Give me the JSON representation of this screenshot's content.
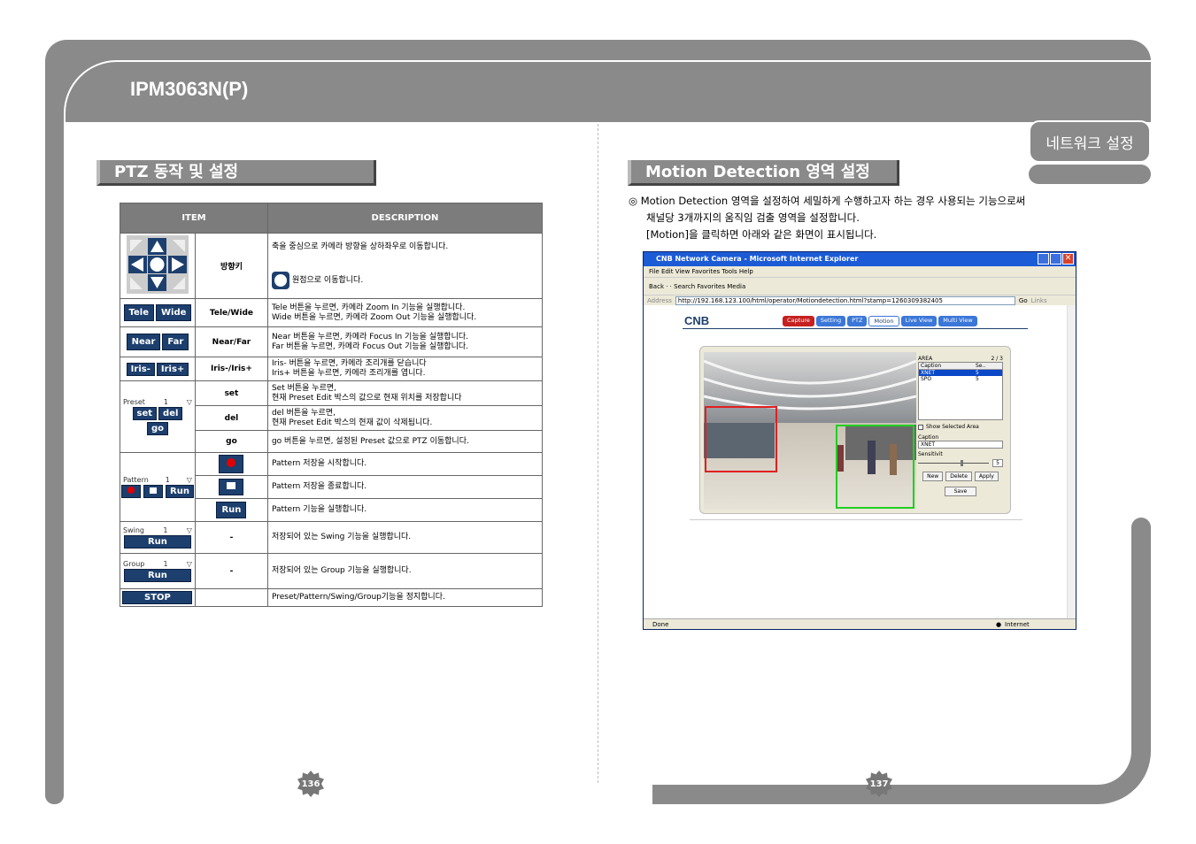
{
  "header": {
    "title": "IPM3063N(P)",
    "section_tab": "네트워크 설정"
  },
  "left": {
    "heading": "PTZ 동작 및 설정",
    "table": {
      "col_item": "ITEM",
      "col_desc": "DESCRIPTION",
      "rows": {
        "dir": {
          "name": "방향키",
          "desc1": "축을 중심으로 카메라 방향을 상하좌우로 이동합니다.",
          "desc2": "원점으로 이동합니다."
        },
        "tele": {
          "btn1": "Tele",
          "btn2": "Wide",
          "name": "Tele/Wide",
          "desc1": "Tele 버튼을 누르면, 카메라 Zoom In 기능을 실행합니다.",
          "desc2": "Wide 버튼을 누르면, 카메라 Zoom Out 기능을 실행합니다."
        },
        "near": {
          "btn1": "Near",
          "btn2": "Far",
          "name": "Near/Far",
          "desc1": "Near 버튼을 누르면, 카메라 Focus In 기능을 실행합니다.",
          "desc2": "Far 버튼을 누르면, 카메라 Focus Out 기능을 실행합니다."
        },
        "iris": {
          "btn1": "Iris-",
          "btn2": "Iris+",
          "name": "Iris-/Iris+",
          "desc1": "Iris- 버튼을 누르면, 카메라 조리개를 닫습니다",
          "desc2": "Iris+ 버튼을 누르면, 카메라 조리개를 엽니다."
        },
        "preset": {
          "label": "Preset",
          "value": "1",
          "btn_set": "set",
          "btn_del": "del",
          "btn_go": "go",
          "set_name": "set",
          "set_desc1": "Set 버튼을 누르면,",
          "set_desc2": "현재 Preset Edit 박스의 값으로 현재 위치를 저장합니다",
          "del_name": "del",
          "del_desc1": "del 버튼을 누르면,",
          "del_desc2": "현재 Preset Edit 박스의 현재 값이 삭제됩니다.",
          "go_name": "go",
          "go_desc": "go 버튼을 누르면, 설정된 Preset 값으로 PTZ 이동합니다."
        },
        "pattern": {
          "label": "Pattern",
          "value": "1",
          "run": "Run",
          "desc_rec": "Pattern 저장을 시작합니다.",
          "desc_stop": "Pattern 저장을 종료합니다.",
          "desc_run": "Pattern 기능을 실행합니다."
        },
        "swing": {
          "label": "Swing",
          "value": "1",
          "run": "Run",
          "name": "-",
          "desc": "저장되어 있는 Swing 기능을 실행합니다."
        },
        "group": {
          "label": "Group",
          "value": "1",
          "run": "Run",
          "name": "-",
          "desc": "저장되어 있는 Group 기능을 실행합니다."
        },
        "stop": {
          "btn": "STOP",
          "desc": "Preset/Pattern/Swing/Group기능을 정지합니다."
        }
      }
    },
    "page": "136"
  },
  "right": {
    "heading": "Motion Detection 영역 설정",
    "intro1": "◎ Motion Detection 영역을 설정하여 세밀하게 수행하고자 하는 경우 사용되는 기능으로써",
    "intro2": "채널당 3개까지의 움직임 검출 영역을 설정합니다.",
    "intro3": "[Motion]을 클릭하면 아래와 같은 화면이 표시됩니다.",
    "browser": {
      "title": "CNB Network Camera - Microsoft Internet Explorer",
      "menu": "File   Edit   View   Favorites   Tools   Help",
      "toolbar": "Back  ·  ·  Search  Favorites  Media",
      "address_label": "Address",
      "address": "http://192.168.123.100/html/operator/Motiondetection.html?stamp=1260309382405",
      "go": "Go",
      "links": "Links",
      "logo": "CNB",
      "nav": [
        "Capture",
        "Setting",
        "PTZ",
        "Motion",
        "Live View",
        "Multi View"
      ],
      "area_label": "AREA",
      "area_count": "2 / 3",
      "list_cols": [
        "Caption",
        "Se.."
      ],
      "list_rows": [
        [
          "XNET",
          "5"
        ],
        [
          "SPO",
          "5"
        ]
      ],
      "show_selected": "Show Selected Area",
      "caption_label": "Caption",
      "caption_value": "XNET",
      "sens_label": "Sensitivit",
      "sens_value": "5",
      "btn_new": "New",
      "btn_delete": "Delete",
      "btn_apply": "Apply",
      "btn_save": "Save",
      "status_left": "Done",
      "status_right": "Internet"
    },
    "page": "137"
  },
  "colors": {
    "frame": "#8a8a8a",
    "button": "#1d3f6e",
    "record": "#e00000"
  }
}
